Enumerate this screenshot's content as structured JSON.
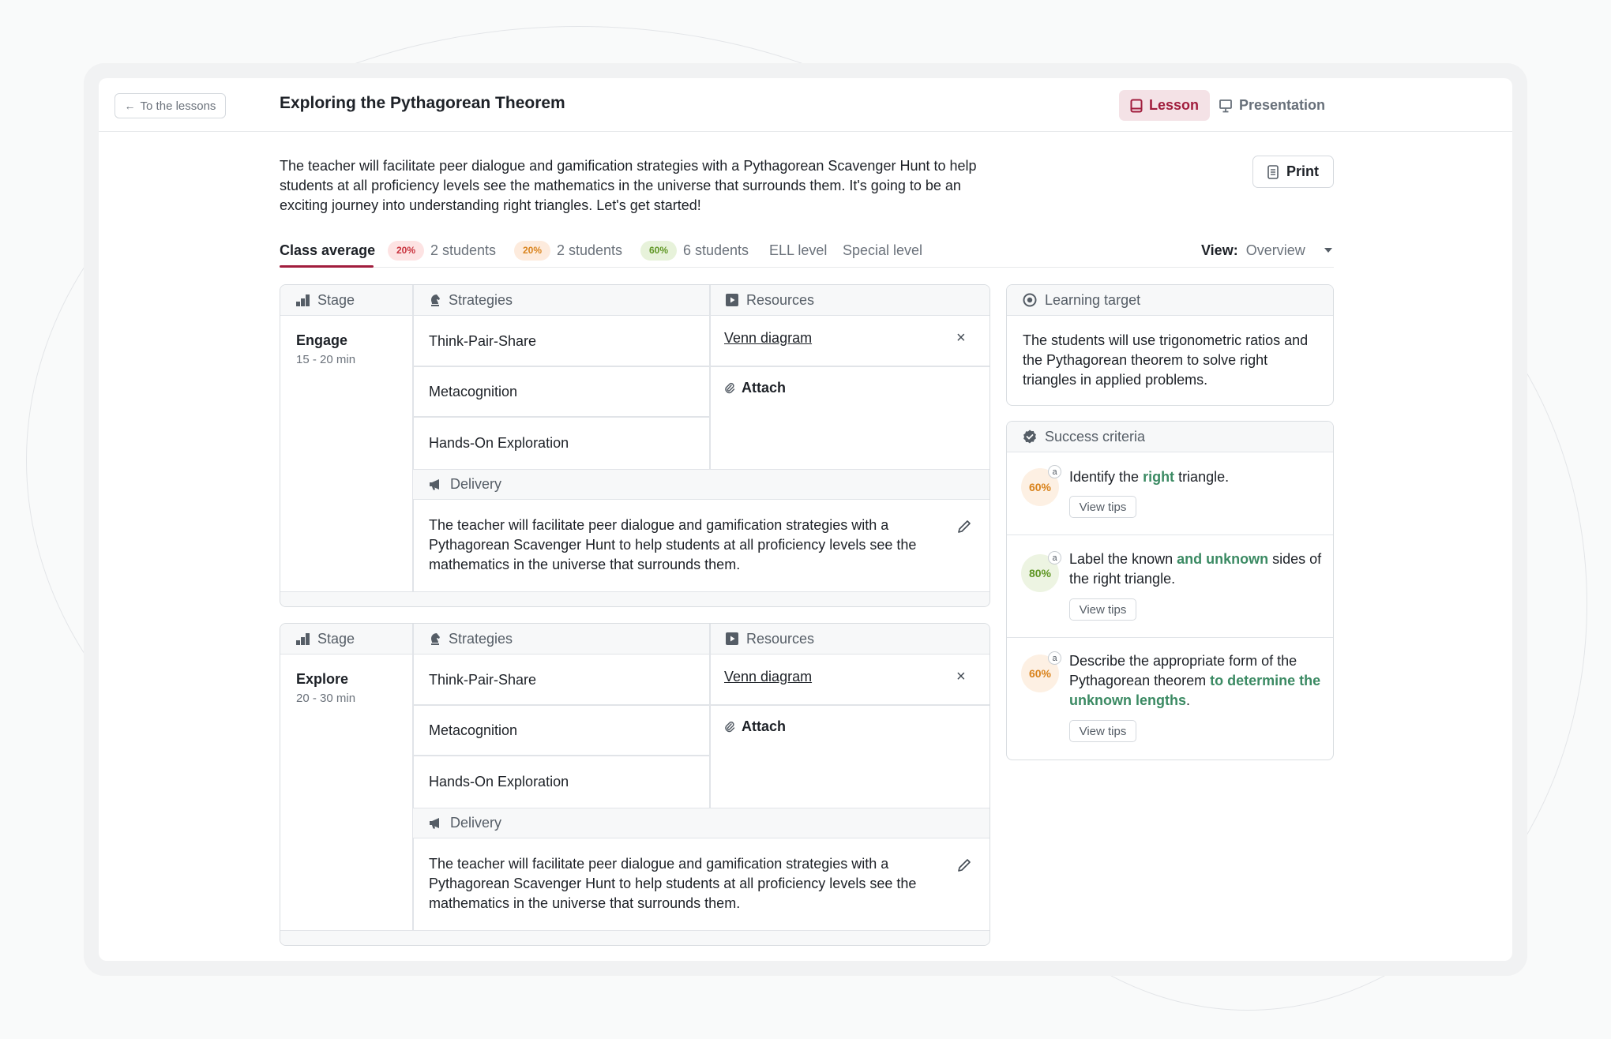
{
  "header": {
    "back_label": "To the lessons",
    "title": "Exploring the Pythagorean Theorem",
    "tabs": [
      {
        "label": "Lesson",
        "active": true
      },
      {
        "label": "Presentation",
        "active": false
      }
    ]
  },
  "intro": "The teacher will facilitate peer dialogue and gamification strategies with a Pythagorean Scavenger Hunt to help students at all proficiency levels see the mathematics in the universe that surrounds them. It's going to be an exciting journey into understanding right triangles. Let's get started!",
  "print_label": "Print",
  "levels": {
    "class_average": "Class average",
    "groups": [
      {
        "pct": "20%",
        "students": "2 students",
        "color": "#c9333e"
      },
      {
        "pct": "20%",
        "students": "2 students",
        "color": "#d9831c"
      },
      {
        "pct": "60%",
        "students": "6 students",
        "color": "#5f9624"
      }
    ],
    "ell": "ELL level",
    "special": "Special level",
    "view_label": "View:",
    "view_value": "Overview"
  },
  "table_headers": {
    "stage": "Stage",
    "strategies": "Strategies",
    "resources": "Resources",
    "delivery": "Delivery"
  },
  "stages": [
    {
      "name": "Engage",
      "time": "15 - 20 min",
      "strategies": [
        "Think-Pair-Share",
        "Metacognition",
        "Hands-On Exploration"
      ],
      "resource": "Venn diagram",
      "attach": "Attach",
      "delivery": "The teacher will facilitate peer dialogue and gamification strategies with a Pythagorean Scavenger Hunt to help students at all proficiency levels see the mathematics in the universe that surrounds them."
    },
    {
      "name": "Explore",
      "time": "20 - 30 min",
      "strategies": [
        "Think-Pair-Share",
        "Metacognition",
        "Hands-On Exploration"
      ],
      "resource": "Venn diagram",
      "attach": "Attach",
      "delivery": "The teacher will facilitate peer dialogue and gamification strategies with a Pythagorean Scavenger Hunt to help students at all proficiency levels see the mathematics in the universe that surrounds them."
    }
  ],
  "learning_target": {
    "title": "Learning target",
    "text": "The students will use trigonometric ratios and the Pythagorean theorem to solve right triangles in applied problems."
  },
  "success_criteria": {
    "title": "Success criteria",
    "badge_letter": "a",
    "tips_label": "View tips",
    "items": [
      {
        "pct": "60%",
        "pre": "Identify the ",
        "hl": "right",
        "post": " triangle."
      },
      {
        "pct": "80%",
        "pre": "Label the known ",
        "hl": "and unknown",
        "post": " sides of the right triangle."
      },
      {
        "pct": "60%",
        "pre": "Describe the appropriate form of the Pythagorean theorem ",
        "hl": "to determine the unknown lengths",
        "post": "."
      }
    ]
  },
  "colors": {
    "accent": "#a11d3d",
    "highlight": "#3b8a63"
  }
}
